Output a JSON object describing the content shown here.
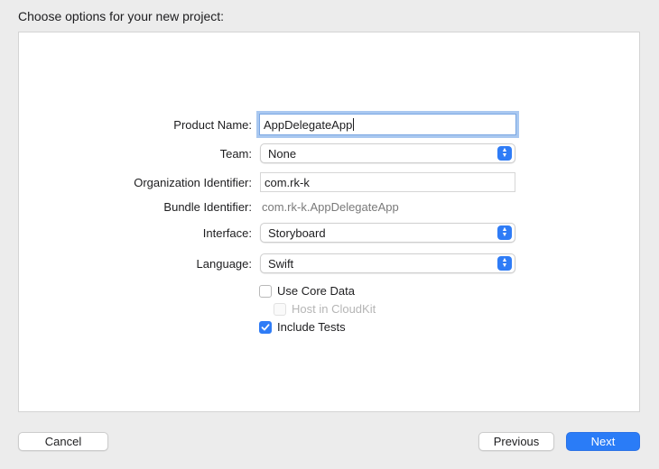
{
  "dialog": {
    "heading": "Choose options for your new project:"
  },
  "form": {
    "product_name": {
      "label": "Product Name:",
      "value": "AppDelegateApp"
    },
    "team": {
      "label": "Team:",
      "value": "None"
    },
    "organization_identifier": {
      "label": "Organization Identifier:",
      "value": "com.rk-k"
    },
    "bundle_identifier": {
      "label": "Bundle Identifier:",
      "value": "com.rk-k.AppDelegateApp"
    },
    "interface": {
      "label": "Interface:",
      "value": "Storyboard"
    },
    "language": {
      "label": "Language:",
      "value": "Swift"
    },
    "use_core_data": {
      "label": "Use Core Data",
      "checked": false
    },
    "host_in_cloudkit": {
      "label": "Host in CloudKit",
      "checked": false,
      "enabled": false
    },
    "include_tests": {
      "label": "Include Tests",
      "checked": true
    }
  },
  "footer": {
    "cancel_label": "Cancel",
    "previous_label": "Previous",
    "next_label": "Next"
  },
  "colors": {
    "accent": "#2a7cf7",
    "focus_ring": "#a9c8f0"
  },
  "icons": {
    "popup_arrows": "chevron-up-down-icon",
    "checkmark": "checkmark-icon"
  }
}
